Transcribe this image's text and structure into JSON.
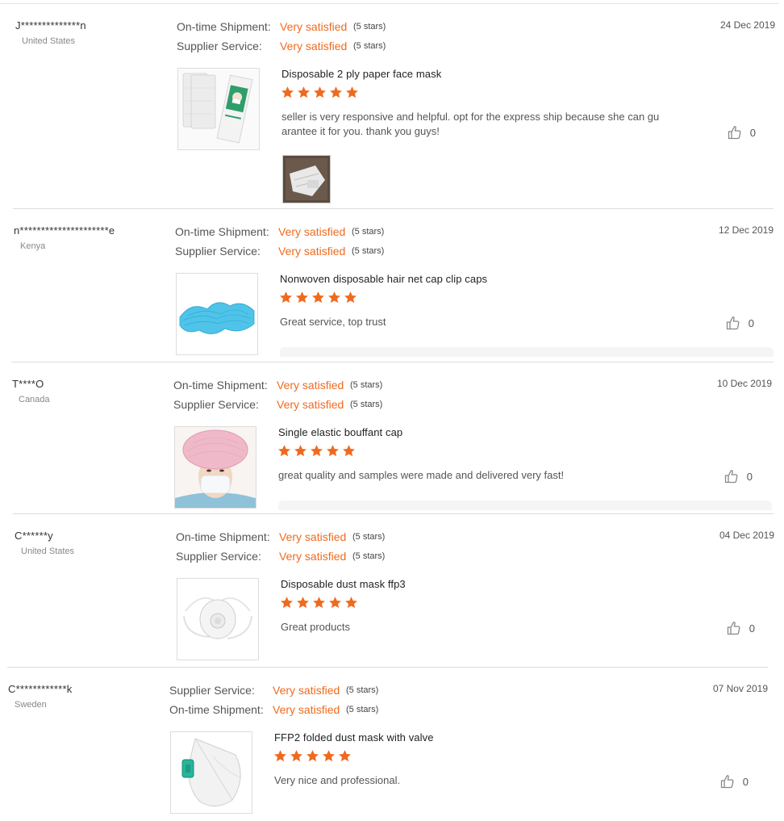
{
  "accent_color": "#f06a1e",
  "reviews": [
    {
      "buyer": "J**************n",
      "country": "United States",
      "ratings": [
        {
          "label": "On-time Shipment:",
          "value": "Very satisfied",
          "stars": "(5 stars)"
        },
        {
          "label": "Supplier Service:",
          "value": "Very satisfied",
          "stars": "(5 stars)"
        }
      ],
      "date": "24 Dec 2019",
      "product": "Disposable 2 ply paper face mask",
      "product_rating": 5,
      "comment": "seller is very responsive and helpful. opt for the express ship because she can gu arantee it for you. thank you guys!",
      "likes": "0",
      "thumb_icon": "paper-face-mask-pack-image",
      "attachment_icon": "buyer-photo-thumbnail"
    },
    {
      "buyer": "n*********************e",
      "country": "Kenya",
      "ratings": [
        {
          "label": "On-time Shipment:",
          "value": "Very satisfied",
          "stars": "(5 stars)"
        },
        {
          "label": "Supplier Service:",
          "value": "Very satisfied",
          "stars": "(5 stars)"
        }
      ],
      "date": "12 Dec 2019",
      "product": "Nonwoven disposable hair net cap clip caps",
      "product_rating": 5,
      "comment": "Great service, top trust",
      "likes": "0",
      "thumb_icon": "blue-clip-caps-image"
    },
    {
      "buyer": "T****O",
      "country": "Canada",
      "ratings": [
        {
          "label": "On-time Shipment:",
          "value": "Very satisfied",
          "stars": "(5 stars)"
        },
        {
          "label": "Supplier Service:",
          "value": "Very satisfied",
          "stars": "(5 stars)"
        }
      ],
      "date": "10 Dec 2019",
      "product": "Single elastic bouffant cap",
      "product_rating": 5,
      "comment": "great quality and samples were made and delivered very fast!",
      "likes": "0",
      "thumb_icon": "bouffant-cap-model-image"
    },
    {
      "buyer": "C******y",
      "country": "United States",
      "ratings": [
        {
          "label": "On-time Shipment:",
          "value": "Very satisfied",
          "stars": "(5 stars)"
        },
        {
          "label": "Supplier Service:",
          "value": "Very satisfied",
          "stars": "(5 stars)"
        }
      ],
      "date": "04 Dec 2019",
      "product": "Disposable dust mask ffp3",
      "product_rating": 5,
      "comment": "Great products",
      "likes": "0",
      "thumb_icon": "ffp3-dust-mask-image"
    },
    {
      "buyer": "C************k",
      "country": "Sweden",
      "ratings": [
        {
          "label": "Supplier Service:",
          "value": "Very satisfied",
          "stars": "(5 stars)"
        },
        {
          "label": "On-time Shipment:",
          "value": "Very satisfied",
          "stars": "(5 stars)"
        }
      ],
      "date": "07 Nov 2019",
      "product": "FFP2 folded dust mask with valve",
      "product_rating": 5,
      "comment": "Very nice and professional.",
      "likes": "0",
      "thumb_icon": "ffp2-folded-mask-image"
    }
  ]
}
